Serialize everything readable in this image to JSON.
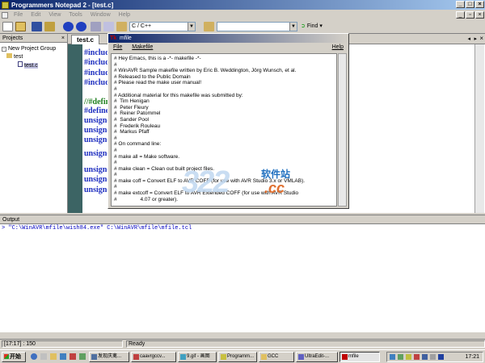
{
  "titlebar": {
    "title": "Programmers Notepad 2 - [test.c]"
  },
  "menubar": {
    "items": [
      "File",
      "Edit",
      "View",
      "Tools",
      "Window",
      "Help"
    ]
  },
  "toolbar": {
    "language": "C / C++",
    "find_label": "Find"
  },
  "projects": {
    "title": "Projects",
    "group": "New Project Group",
    "project": "test",
    "file": "test.c"
  },
  "editor": {
    "tab_label": "test.c",
    "lines": [
      "#includ",
      "#includ",
      "#includ",
      "#includ",
      "//#defin",
      "#define",
      "unsigne",
      "unsigne",
      "unsigne",
      "unsigne",
      "unsigne",
      "unsigne",
      "unsigne"
    ]
  },
  "mfile": {
    "title": "mfile",
    "menu_file": "File",
    "menu_makefile": "Makefile",
    "menu_help": "Help",
    "body": "# Hey Emacs, this is a -*- makefile -*-\n#\n# WinAVR Sample makefile written by Eric B. Weddington, Jörg Wunsch, et al.\n# Released to the Public Domain\n# Please read the make user manual!\n#\n# Additional material for this makefile was submitted by:\n#  Tim Henigan\n#  Peter Fleury\n#  Reiner Patommel\n#  Sander Pool\n#  Frederik Rouleau\n#  Markus Pfaff\n#\n# On command line:\n#\n# make all = Make software.\n#\n# make clean = Clean out built project files.\n#\n# make coff = Convert ELF to AVR COFF (for use with AVR Studio 3.x or VMLAB).\n#\n# make extcoff = Convert ELF to AVR Extended COFF (for use with AVR Studio\n#                4.07 or greater)."
  },
  "output": {
    "title": "Output",
    "line": "> \"C:\\WinAVR\\mfile\\wish84.exe\" C:\\WinAVR\\mfile\\mfile.tcl"
  },
  "status": {
    "position": "[17:17] : 150",
    "message": "Ready"
  },
  "taskbar": {
    "start": "开始",
    "tasks": [
      "发现庆禽...",
      "caavrgccv...",
      "9.gif - 画图",
      "Programm...",
      "GCC",
      "UltraEdit-...",
      "mfile"
    ],
    "clock": "17:21"
  },
  "watermark": {
    "number": "322",
    "cn": "软件站",
    "suffix": ".cc"
  },
  "colors": {
    "title_start": "#0a246a",
    "code_blue": "#2030c0",
    "gutter": "#3c6464"
  }
}
